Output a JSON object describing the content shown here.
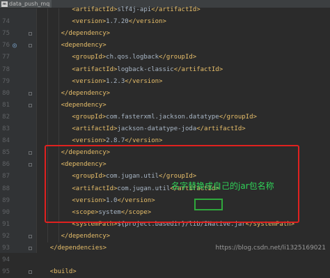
{
  "tab": {
    "label": "data_push_mq",
    "icon": "maven-file-icon"
  },
  "lines": [
    {
      "num": "",
      "indent": 3,
      "open": "<artifactId>",
      "text": "slf4j-api",
      "close": "</artifactId>"
    },
    {
      "num": "74",
      "indent": 3,
      "open": "<version>",
      "text": "1.7.20",
      "close": "</version>"
    },
    {
      "num": "75",
      "indent": 2,
      "open": "</dependency>",
      "text": "",
      "close": ""
    },
    {
      "num": "76",
      "indent": 2,
      "open": "<dependency>",
      "text": "",
      "close": ""
    },
    {
      "num": "77",
      "indent": 3,
      "open": "<groupId>",
      "text": "ch.qos.logback",
      "close": "</groupId>"
    },
    {
      "num": "78",
      "indent": 3,
      "open": "<artifactId>",
      "text": "logback-classic",
      "close": "</artifactId>"
    },
    {
      "num": "79",
      "indent": 3,
      "open": "<version>",
      "text": "1.2.3",
      "close": "</version>"
    },
    {
      "num": "80",
      "indent": 2,
      "open": "</dependency>",
      "text": "",
      "close": ""
    },
    {
      "num": "81",
      "indent": 2,
      "open": "<dependency>",
      "text": "",
      "close": ""
    },
    {
      "num": "82",
      "indent": 3,
      "open": "<groupId>",
      "text": "com.fasterxml.jackson.datatype",
      "close": "</groupId>"
    },
    {
      "num": "83",
      "indent": 3,
      "open": "<artifactId>",
      "text": "jackson-datatype-joda",
      "close": "</artifactId>"
    },
    {
      "num": "84",
      "indent": 3,
      "open": "<version>",
      "text": "2.8.7",
      "close": "</version>"
    },
    {
      "num": "85",
      "indent": 2,
      "open": "</dependency>",
      "text": "",
      "close": ""
    },
    {
      "num": "86",
      "indent": 2,
      "open": "<dependency>",
      "text": "",
      "close": ""
    },
    {
      "num": "87",
      "indent": 3,
      "open": "<groupId>",
      "text": "com.jugan.util",
      "close": "</groupId>"
    },
    {
      "num": "88",
      "indent": 3,
      "open": "<artifactId>",
      "text": "com.jugan.util",
      "close": "</artifactId>"
    },
    {
      "num": "89",
      "indent": 3,
      "open": "<version>",
      "text": "1.0",
      "close": "</version>"
    },
    {
      "num": "90",
      "indent": 3,
      "open": "<scope>",
      "text": "system",
      "close": "</scope>"
    },
    {
      "num": "91",
      "indent": 3,
      "open": "<systemPath>",
      "text": "${project.basedir}/lib/INative.jar",
      "close": "</systemPath>"
    },
    {
      "num": "92",
      "indent": 2,
      "open": "</dependency>",
      "text": "",
      "close": ""
    },
    {
      "num": "93",
      "indent": 1,
      "open": "</dependencies>",
      "text": "",
      "close": ""
    },
    {
      "num": "94",
      "indent": 0,
      "open": "",
      "text": "",
      "close": ""
    },
    {
      "num": "95",
      "indent": 1,
      "open": "<build>",
      "text": "",
      "close": ""
    }
  ],
  "annotation": "名字替换成自己的jar包名称",
  "watermark": "https://blog.csdn.net/li1325169021",
  "colors": {
    "tag": "#e8bf6a",
    "text": "#a9b7c6",
    "highlight_red": "#e0211f",
    "highlight_green": "#2fa83c",
    "annotation": "#30d158"
  }
}
